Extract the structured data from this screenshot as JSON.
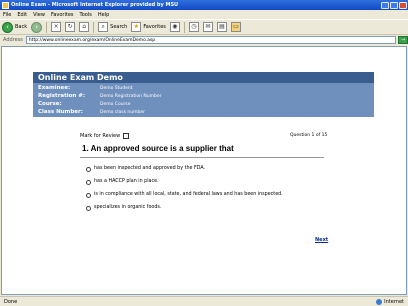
{
  "window": {
    "title": "Online Exam - Microsoft Internet Explorer provided by MSU"
  },
  "menu": [
    "File",
    "Edit",
    "View",
    "Favorites",
    "Tools",
    "Help"
  ],
  "toolbar": {
    "back_label": "Back",
    "search_label": "Search",
    "favorites_label": "Favorites"
  },
  "address": {
    "label": "Address",
    "url": "http://www.onlineexam.org/exam/OnlineExamDemo.asp",
    "go_label": "Go"
  },
  "exam": {
    "title": "Online Exam Demo",
    "info": [
      {
        "key": "Examinee:",
        "value": "Demo Student"
      },
      {
        "key": "Registration #:",
        "value": "Demo Registration Number"
      },
      {
        "key": "Course:",
        "value": "Demo Course"
      },
      {
        "key": "Class Number:",
        "value": "Demo class number"
      }
    ],
    "review_label": "Mark for Review",
    "question_count": "Question 1 of 15",
    "question": "1. An approved source is a supplier that",
    "answers": [
      "has been inspected and approved by the FDA.",
      "has a HACCP plan in place.",
      "is in compliance with all local, state, and federal laws and has been inspected.",
      "specializes in organic foods."
    ],
    "next_label": "Next"
  },
  "status": {
    "left": "Done",
    "right": "Internet"
  }
}
